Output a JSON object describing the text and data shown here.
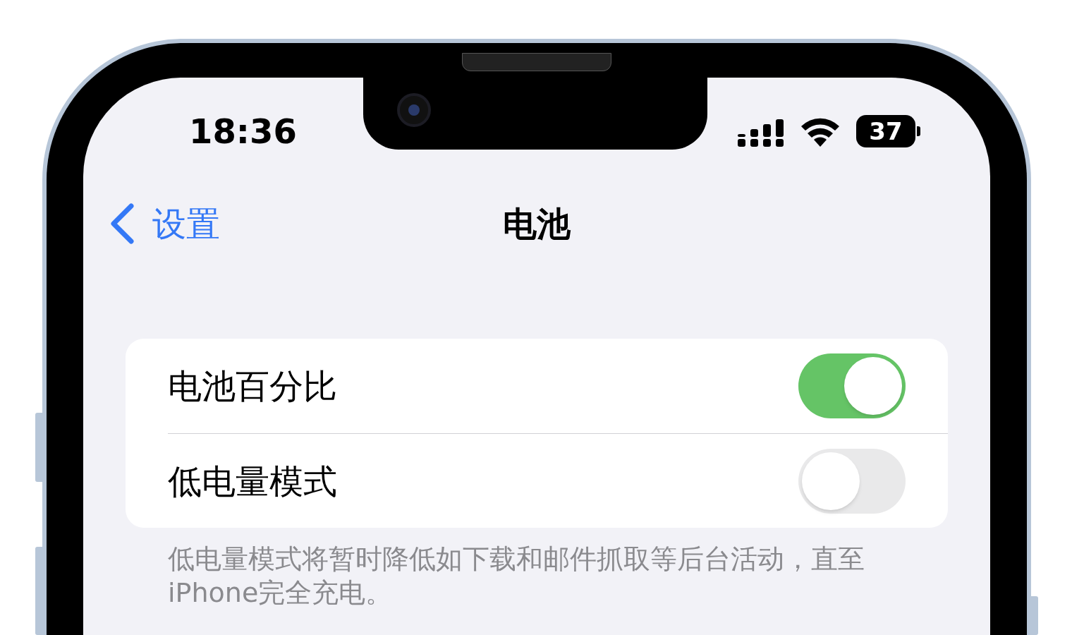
{
  "status_bar": {
    "time": "18:36",
    "battery": "37"
  },
  "nav": {
    "back": "设置",
    "title": "电池"
  },
  "settings": [
    {
      "label": "电池百分比",
      "on": true
    },
    {
      "label": "低电量模式",
      "on": false
    }
  ],
  "footer": "低电量模式将暂时降低如下载和邮件抓取等后台活动，直至iPhone完全充电。"
}
